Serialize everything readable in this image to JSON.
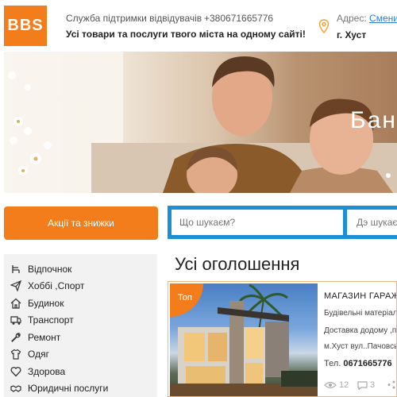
{
  "header": {
    "logo_text": "BBS",
    "support_label": "Служба підтримки відвідувачів",
    "phone": "+380671665776",
    "slogan": "Усі товари та послуги твого міста на одному сайті!",
    "address_label": "Адрес:",
    "address_change": "Сменит",
    "city": "г. Хуст"
  },
  "banner": {
    "text": "Бан"
  },
  "search": {
    "promo_button": "Акції та знижки",
    "query_placeholder": "Що шукаєм?",
    "where_placeholder": "Дэ шукаєм"
  },
  "sidebar": {
    "items": [
      {
        "label": "Відпочнок",
        "icon": "chair-icon"
      },
      {
        "label": "Хоббі ,Спорт",
        "icon": "paper-plane-icon"
      },
      {
        "label": "Будинок",
        "icon": "house-icon"
      },
      {
        "label": "Транспорт",
        "icon": "truck-icon"
      },
      {
        "label": "Ремонт",
        "icon": "wrench-icon"
      },
      {
        "label": "Одяг",
        "icon": "shirt-icon"
      },
      {
        "label": "Здорова",
        "icon": "heart-icon"
      },
      {
        "label": "Юридичні послуги",
        "icon": "handshake-icon"
      }
    ]
  },
  "main": {
    "title": "Усі оголошення",
    "listing": {
      "badge": "Топ",
      "title": "МАГАЗИН ГАРАЖ",
      "line1": "Будівельні матеріали",
      "line2": "Доставка додому ,п",
      "line3": "м.Хуст вул..Пачовсь",
      "phone_label": "Тел.",
      "phone": "0671665776",
      "views": "12",
      "comments": "3"
    }
  },
  "colors": {
    "accent": "#f47d1b",
    "search_border": "#1a8fd4",
    "sidebar_bg": "#f2f2f2"
  }
}
